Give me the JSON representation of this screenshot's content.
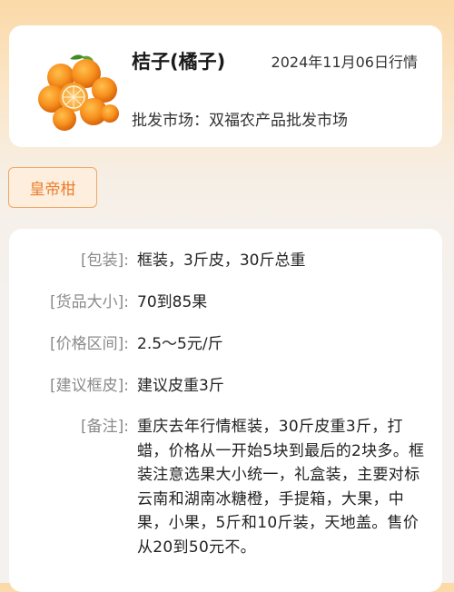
{
  "header": {
    "title": "桔子(橘子)",
    "date": "2024年11月06日行情",
    "market": "批发市场：双福农产品批发市场",
    "image_icon": "mandarin-oranges-photo"
  },
  "variety": {
    "label": "皇帝柑"
  },
  "details": {
    "packaging_label": "[包装]:",
    "packaging_value": "框装，3斤皮，30斤总重",
    "size_label": "[货品大小]:",
    "size_value": "70到85果",
    "price_label": "[价格区间]:",
    "price_value": "2.5～5元/斤",
    "tare_label": "[建议框皮]:",
    "tare_value": "建议皮重3斤",
    "note_label": "[备注]:",
    "note_value": "重庆去年行情框装，30斤皮重3斤，打蜡，价格从一开始5块到最后的2块多。框装注意选果大小统一，礼盒装，主要对标云南和湖南冰糖橙，手提箱，大果，中果，小果，5斤和10斤装，天地盖。售价从20到50元不。"
  },
  "colors": {
    "accent": "#ec7d2c",
    "tag_border": "#f0a866",
    "tag_bg": "#fdeedd"
  }
}
